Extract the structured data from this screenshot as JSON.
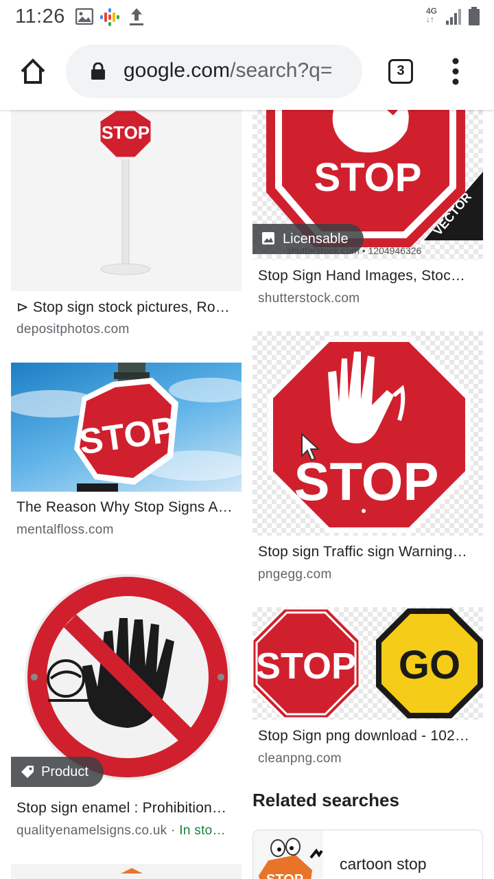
{
  "status_bar": {
    "time": "11:26",
    "network": "4G"
  },
  "browser": {
    "url_host": "google.com",
    "url_path": "/search?q=",
    "tab_count": "3"
  },
  "results": [
    {
      "caption": "⊳ Stop sign stock pictures, Ro…",
      "source": "depositphotos.com",
      "sign_text": "STOP"
    },
    {
      "caption": "Stop Sign Hand Images, Stoc…",
      "source": "shutterstock.com",
      "badge": "Licensable",
      "sign_text": "STOP",
      "watermark": "shutterstock.com • 1204946326",
      "ribbon": "VECTOR"
    },
    {
      "caption": "The Reason Why Stop Signs A…",
      "source": "mentalfloss.com",
      "sign_text": "STOP"
    },
    {
      "caption": "Stop sign Traffic sign Warning…",
      "source": "pngegg.com",
      "sign_text": "STOP"
    },
    {
      "caption": "Stop sign enamel : Prohibition…",
      "source": "qualityenamelsigns.co.uk",
      "source_extra": " · In sto…",
      "badge": "Product"
    },
    {
      "caption": "Stop Sign png download - 102…",
      "source": "cleanpng.com",
      "sign_text": "STOP",
      "sign_text_2": "GO"
    }
  ],
  "related": {
    "title": "Related searches",
    "items": [
      {
        "label": "cartoon stop",
        "thumb_text": "STOP"
      }
    ]
  },
  "colors": {
    "stop_red": "#d0202e",
    "go_yellow": "#f5cc17",
    "sky_blue": "#3a9ad9"
  }
}
